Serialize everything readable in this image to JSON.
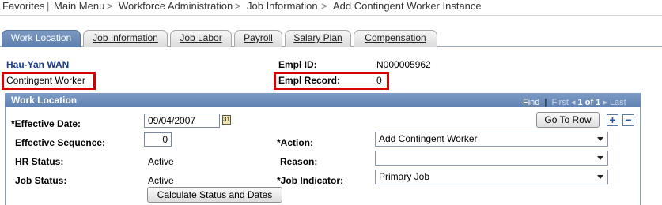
{
  "breadcrumb": {
    "items": [
      "Favorites",
      "Main Menu",
      "Workforce Administration",
      "Job Information",
      "Add Contingent Worker Instance"
    ],
    "separator": ">"
  },
  "tabs": [
    {
      "label": "Work Location",
      "active": true
    },
    {
      "label": "Job Information",
      "active": false
    },
    {
      "label": "Job Labor",
      "active": false
    },
    {
      "label": "Payroll",
      "active": false
    },
    {
      "label": "Salary Plan",
      "active": false
    },
    {
      "label": "Compensation",
      "active": false
    }
  ],
  "header": {
    "employee_name": "Hau-Yan WAN",
    "worker_type": "Contingent Worker",
    "empl_id_label": "Empl ID:",
    "empl_id": "N000005962",
    "empl_record_label": "Empl Record:",
    "empl_record": "0"
  },
  "work_location": {
    "title": "Work Location",
    "nav": {
      "find": "Find",
      "first": "First",
      "count": "1 of 1",
      "last": "Last"
    },
    "go_to_row": "Go To Row",
    "add_row": "+",
    "delete_row": "−",
    "effective_date_label": "*Effective Date:",
    "effective_date": "09/04/2007",
    "calendar_icon": "31",
    "effective_sequence_label": "Effective Sequence:",
    "effective_sequence": "0",
    "action_label": "*Action:",
    "action": "Add Contingent Worker",
    "hr_status_label": "HR Status:",
    "hr_status": "Active",
    "reason_label": "Reason:",
    "reason": "",
    "job_status_label": "Job Status:",
    "job_status": "Active",
    "job_indicator_label": "*Job Indicator:",
    "job_indicator": "Primary Job",
    "calculate_button": "Calculate Status and Dates"
  },
  "colors": {
    "highlight": "#d60000",
    "header_blue": "#5f82b3",
    "name_blue": "#1a3c8c"
  }
}
